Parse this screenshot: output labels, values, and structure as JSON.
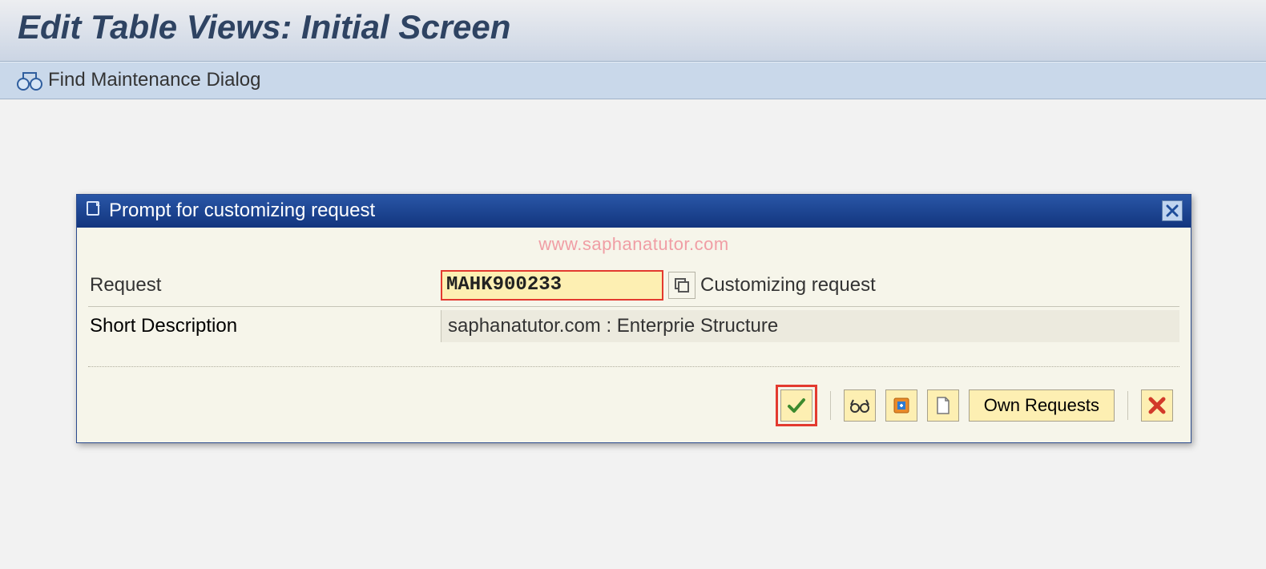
{
  "header": {
    "title": "Edit Table Views: Initial Screen"
  },
  "toolbar": {
    "find_label": "Find Maintenance Dialog"
  },
  "watermark": "www.saphanatutor.com",
  "dialog": {
    "title": "Prompt for customizing request",
    "fields": {
      "request_label": "Request",
      "request_value": "MAHK900233",
      "request_type_text": "Customizing request",
      "short_desc_label": "Short Description",
      "short_desc_value": "saphanatutor.com : Enterprie Structure"
    },
    "buttons": {
      "own_requests_label": "Own Requests"
    }
  }
}
